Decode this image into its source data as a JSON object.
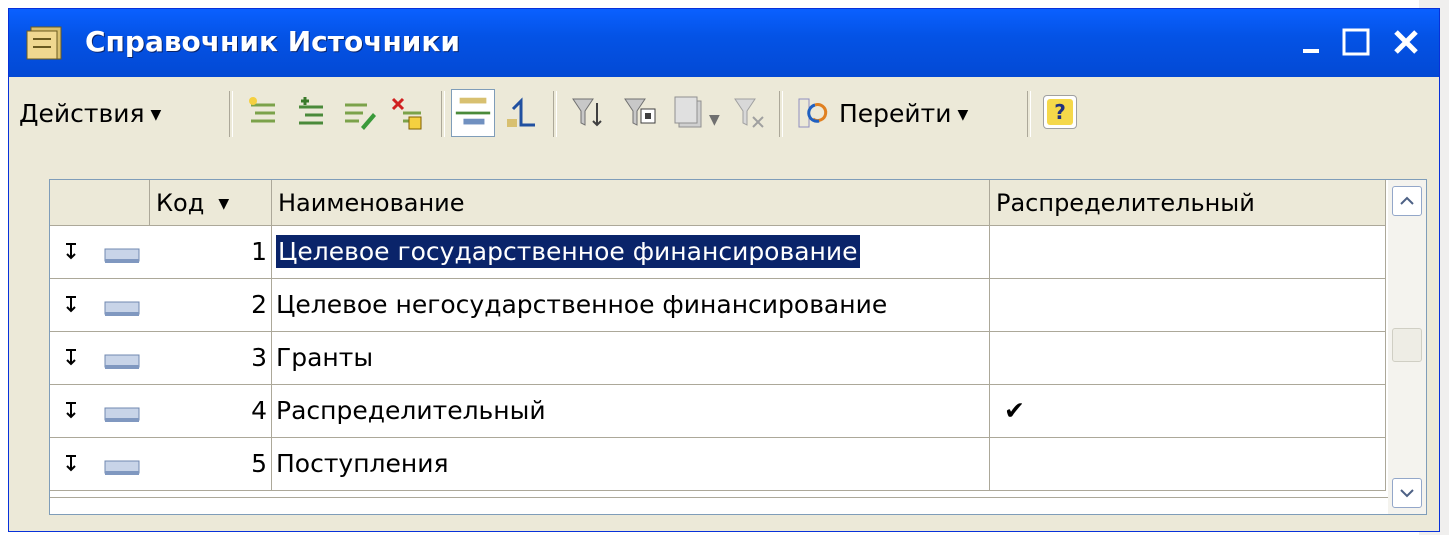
{
  "window": {
    "title": "Справочник Источники",
    "title_icon": "catalog-icon",
    "buttons": [
      "minimize-icon",
      "maximize-icon",
      "close-icon"
    ]
  },
  "toolbar": {
    "actions_label": "Действия",
    "navigate_label": "Перейти",
    "help_label": "?",
    "icons": [
      "add-icon",
      "add-group-icon",
      "edit-icon",
      "delete-icon",
      "hierarchy-view-icon",
      "up-level-icon",
      "filter-icon",
      "filter-by-value-icon",
      "filter-history-icon",
      "clear-filter-icon",
      "refresh-icon",
      "help-icon"
    ]
  },
  "table": {
    "columns": {
      "code": "Код",
      "name": "Наименование",
      "distributive": "Распределительный"
    },
    "rows": [
      {
        "code": "1",
        "name": "Целевое государственное финансирование",
        "distributive": "",
        "selected": true
      },
      {
        "code": "2",
        "name": "Целевое негосударственное финансирование",
        "distributive": ""
      },
      {
        "code": "3",
        "name": "Гранты",
        "distributive": ""
      },
      {
        "code": "4",
        "name": "Распределительный",
        "distributive": "✔"
      },
      {
        "code": "5",
        "name": "Поступления",
        "distributive": ""
      }
    ]
  },
  "colors": {
    "titlebar": "#0453e6",
    "selection": "#0a246a",
    "window_bg": "#ece9d8"
  }
}
